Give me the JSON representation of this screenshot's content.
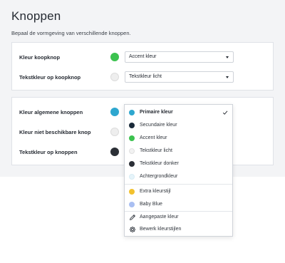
{
  "page": {
    "title": "Knoppen",
    "subtitle": "Bepaal de vormgeving van verschillende knoppen."
  },
  "card1": {
    "rows": [
      {
        "label": "Kleur koopknop",
        "swatch_color": "#3cc24f",
        "select_value": "Accent kleur"
      },
      {
        "label": "Tekstkleur op koopknop",
        "swatch_color": "#eeeeee",
        "select_value": "Tekstkleur licht"
      }
    ]
  },
  "card2": {
    "rows": [
      {
        "label": "Kleur algemene knoppen",
        "swatch_color": "#2ea7cf"
      },
      {
        "label": "Kleur niet beschikbare knop",
        "swatch_color": "#eeeeee"
      },
      {
        "label": "Tekstkleur op knoppen",
        "swatch_color": "#2b2f36"
      }
    ]
  },
  "dropdown": {
    "selected": "Primaire kleur",
    "color_options": [
      {
        "label": "Primaire kleur",
        "color": "#2ea7cf"
      },
      {
        "label": "Secundaire kleur",
        "color": "#1a2a3a"
      },
      {
        "label": "Accent kleur",
        "color": "#3cc24f"
      },
      {
        "label": "Tekstkleur licht",
        "color": "#f2f2f2"
      },
      {
        "label": "Tekstkleur donker",
        "color": "#2b2f36"
      },
      {
        "label": "Achtergrondkleur",
        "color": "#e6f4fa"
      }
    ],
    "extra_options": [
      {
        "label": "Extra kleurstijl",
        "color": "#f2c12e"
      },
      {
        "label": "Baby Blue",
        "color": "#a9bff2"
      }
    ],
    "actions": [
      {
        "label": "Aangepaste kleur",
        "icon": "pencil-icon"
      },
      {
        "label": "Bewerk kleurstijlen",
        "icon": "gear-icon"
      }
    ]
  }
}
